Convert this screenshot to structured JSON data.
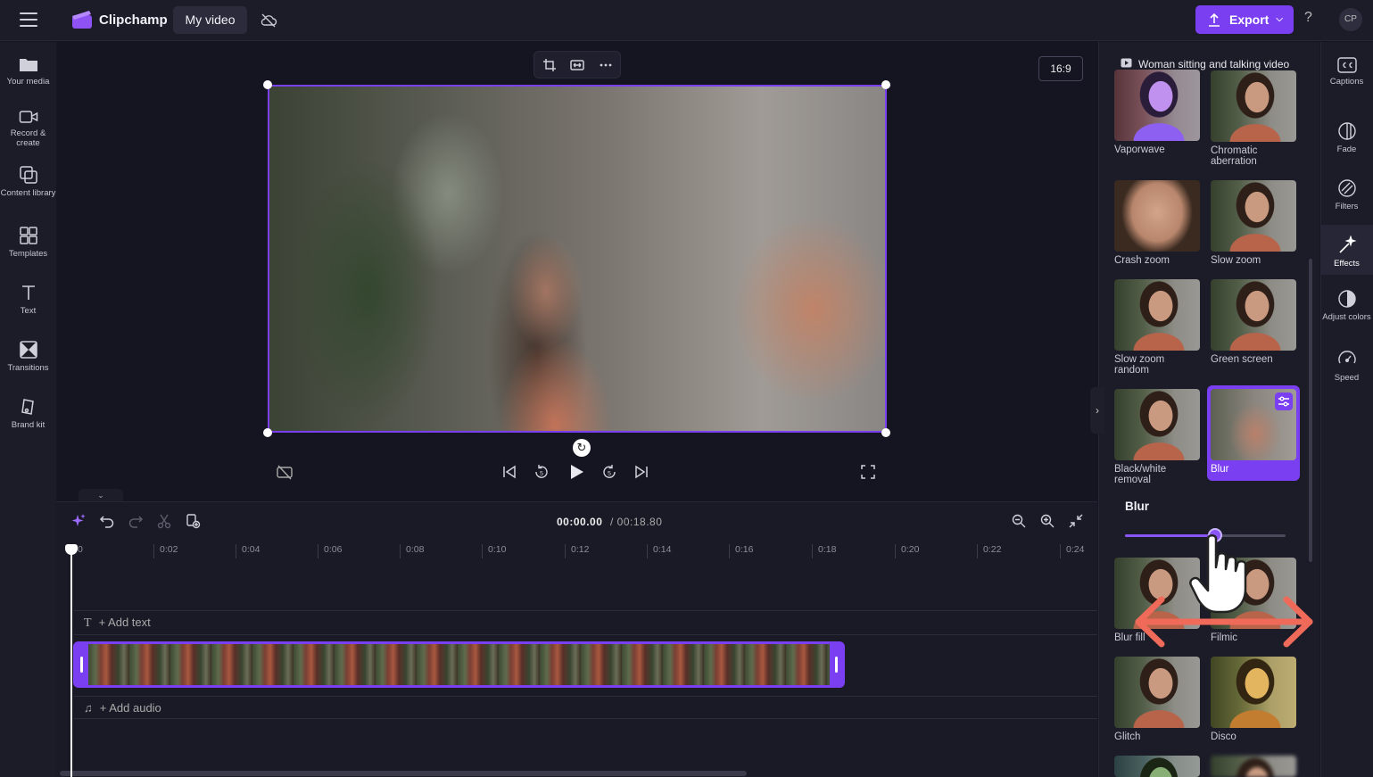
{
  "header": {
    "app_title": "Clipchamp",
    "video_name": "My video",
    "export_label": "Export",
    "help_label": "?",
    "avatar_initials": "CP",
    "accent_color": "#7b3ff2"
  },
  "left_nav": {
    "items": [
      {
        "label": "Your media",
        "icon": "folder-icon"
      },
      {
        "label": "Record & create",
        "icon": "camera-icon"
      },
      {
        "label": "Content library",
        "icon": "content-library-icon"
      },
      {
        "label": "Templates",
        "icon": "templates-icon"
      },
      {
        "label": "Text",
        "icon": "text-icon"
      },
      {
        "label": "Transitions",
        "icon": "transitions-icon"
      },
      {
        "label": "Brand kit",
        "icon": "brand-kit-icon"
      }
    ]
  },
  "preview": {
    "aspect_ratio": "16:9"
  },
  "timeline": {
    "current_time": "00:00.00",
    "total_time": "/ 00:18.80",
    "ruler_ticks": [
      "0",
      "0:02",
      "0:04",
      "0:06",
      "0:08",
      "0:10",
      "0:12",
      "0:14",
      "0:16",
      "0:18",
      "0:20",
      "0:22",
      "0:24"
    ],
    "add_text_label": "+ Add text",
    "add_audio_label": "+ Add audio"
  },
  "effects_panel": {
    "title": "Woman sitting and talking video",
    "effects": [
      {
        "label": "Vaporwave"
      },
      {
        "label": "Chromatic aberration"
      },
      {
        "label": "Crash zoom"
      },
      {
        "label": "Slow zoom"
      },
      {
        "label": "Slow zoom random"
      },
      {
        "label": "Green screen"
      },
      {
        "label": "Black/white removal"
      },
      {
        "label": "Blur",
        "selected": true
      },
      {
        "label": "Blur fill"
      },
      {
        "label": "Filmic"
      },
      {
        "label": "Glitch"
      },
      {
        "label": "Disco"
      }
    ],
    "blur_heading": "Blur",
    "blur_level_fraction": 0.56
  },
  "right_rail": {
    "items": [
      {
        "label": "Captions",
        "icon": "captions-icon"
      },
      {
        "label": "Fade",
        "icon": "fade-icon"
      },
      {
        "label": "Filters",
        "icon": "filters-icon"
      },
      {
        "label": "Effects",
        "icon": "effects-icon",
        "active": true
      },
      {
        "label": "Adjust colors",
        "icon": "adjust-colors-icon"
      },
      {
        "label": "Speed",
        "icon": "speed-icon"
      }
    ]
  }
}
